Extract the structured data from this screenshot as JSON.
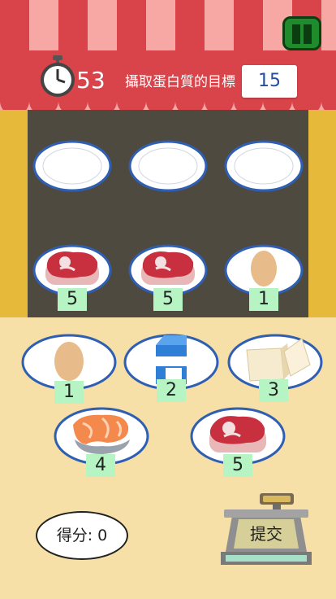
{
  "header": {
    "timer_value": "53",
    "goal_label": "攝取蛋白質的目標",
    "goal_value": "15"
  },
  "shelf": {
    "plates": [
      {
        "item": "empty",
        "value": ""
      },
      {
        "item": "empty",
        "value": ""
      },
      {
        "item": "empty",
        "value": ""
      },
      {
        "item": "steak",
        "value": "5"
      },
      {
        "item": "steak",
        "value": "5"
      },
      {
        "item": "egg",
        "value": "1"
      }
    ]
  },
  "choices": {
    "plates": [
      {
        "item": "egg",
        "value": "1"
      },
      {
        "item": "milk",
        "value": "2"
      },
      {
        "item": "tofu",
        "value": "3"
      },
      {
        "item": "salmon",
        "value": "4"
      },
      {
        "item": "steak",
        "value": "5"
      }
    ]
  },
  "score": {
    "label": "得分: 0"
  },
  "submit": {
    "label": "提交"
  },
  "colors": {
    "awning_red": "#d9434a",
    "awning_pink": "#f7a8a4",
    "stall_yellow": "#e7b93b",
    "shelf_dark": "#4f4a3f",
    "floor": "#f7e0a8",
    "badge": "#b6f4c4"
  }
}
